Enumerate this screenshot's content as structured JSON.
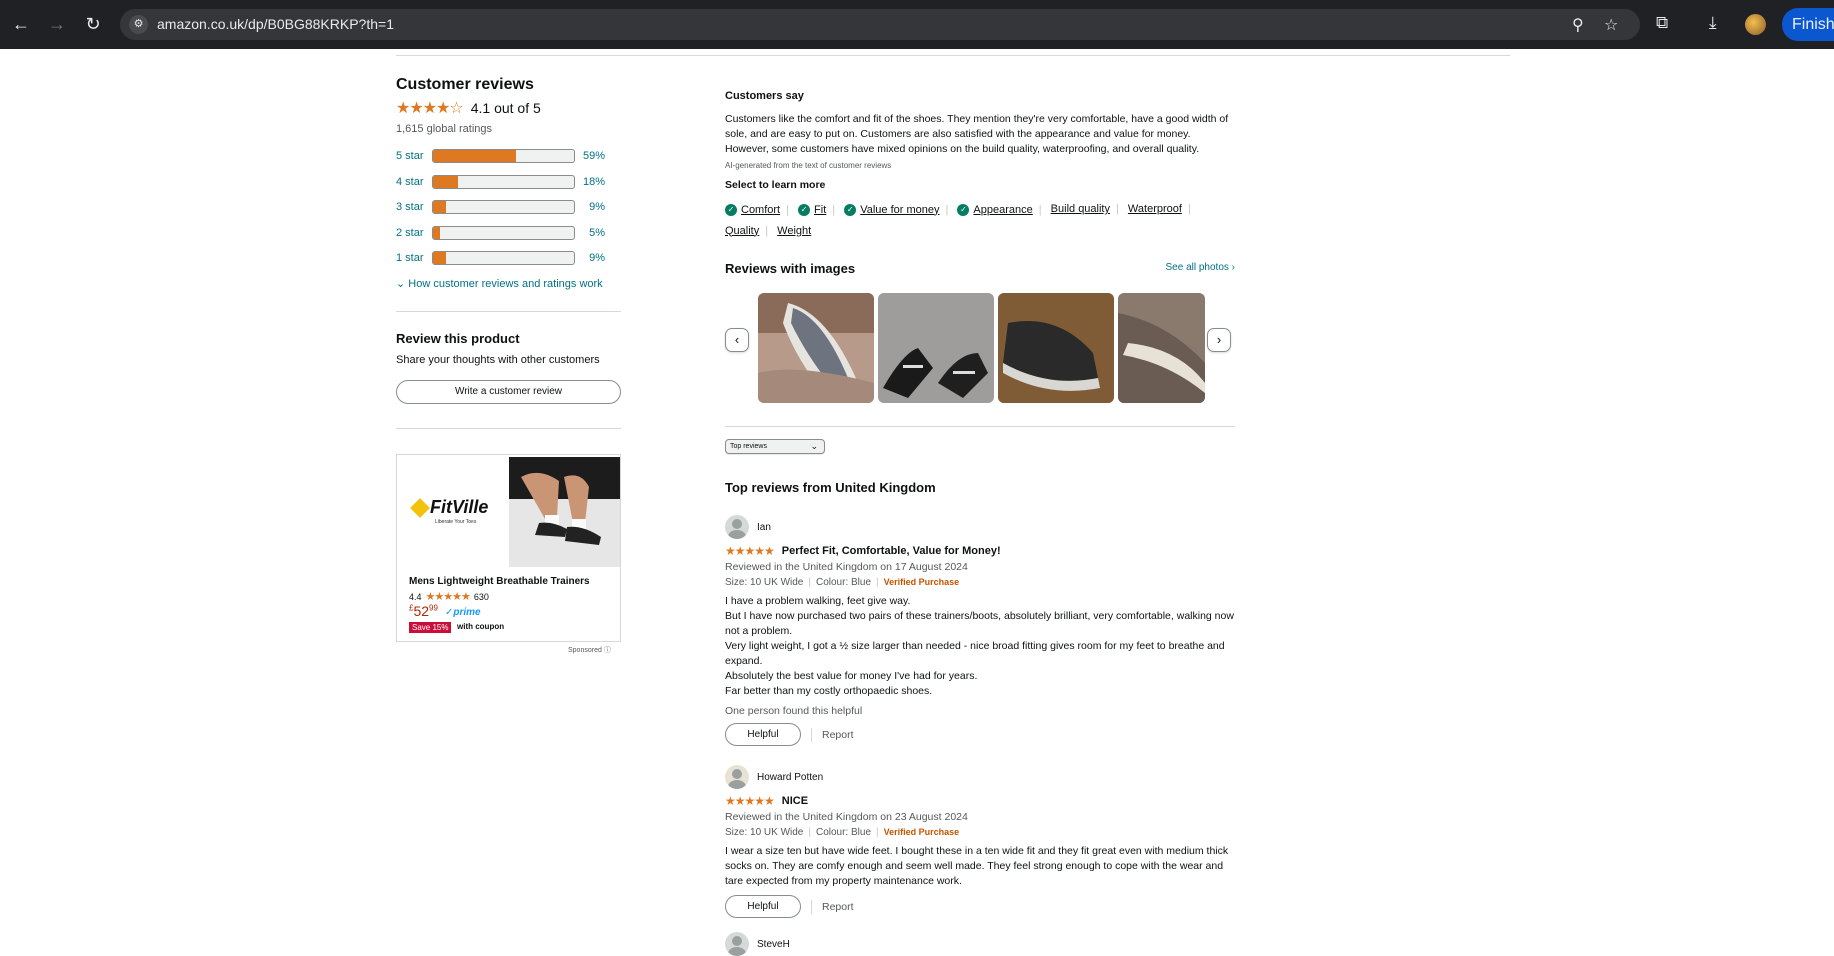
{
  "browser": {
    "url": "amazon.co.uk/dp/B0BG88KRKP?th=1",
    "finish_label": "Finish"
  },
  "ratings": {
    "heading": "Customer reviews",
    "stars": "★★★★☆",
    "average_text": "4.1 out of 5",
    "average": 4.1,
    "global_ratings": "1,615 global ratings",
    "histogram": [
      {
        "label": "5 star",
        "percent_text": "59%",
        "percent": 59
      },
      {
        "label": "4 star",
        "percent_text": "18%",
        "percent": 18
      },
      {
        "label": "3 star",
        "percent_text": "9%",
        "percent": 9
      },
      {
        "label": "2 star",
        "percent_text": "5%",
        "percent": 5
      },
      {
        "label": "1 star",
        "percent_text": "9%",
        "percent": 9
      }
    ],
    "how_link": "How customer reviews and ratings work"
  },
  "review_product": {
    "heading": "Review this product",
    "subtext": "Share your thoughts with other customers",
    "button": "Write a customer review"
  },
  "ad": {
    "brand": "FitVille",
    "tagline": "Liberate Your Toes",
    "title": "Mens Lightweight Breathable Trainers",
    "rating": "4.4",
    "stars": "★★★★★",
    "count": "630",
    "price_currency": "£",
    "price_whole": "52",
    "price_fraction": "99",
    "prime": "prime",
    "save_badge": "Save 15%",
    "coupon_text": "with coupon",
    "sponsored": "Sponsored"
  },
  "customers_say": {
    "heading": "Customers say",
    "summary": "Customers like the comfort and fit of the shoes. They mention they're very comfortable, have a good width of sole, and are easy to put on. Customers are also satisfied with the appearance and value for money. However, some customers have mixed opinions on the build quality, waterproofing, and overall quality.",
    "ai_note": "AI-generated from the text of customer reviews",
    "select_more": "Select to learn more",
    "aspects": [
      {
        "label": "Comfort",
        "positive": true
      },
      {
        "label": "Fit",
        "positive": true
      },
      {
        "label": "Value for money",
        "positive": true
      },
      {
        "label": "Appearance",
        "positive": true
      },
      {
        "label": "Build quality",
        "positive": false
      },
      {
        "label": "Waterproof",
        "positive": false
      },
      {
        "label": "Quality",
        "positive": false
      },
      {
        "label": "Weight",
        "positive": false
      }
    ]
  },
  "images_section": {
    "heading": "Reviews with images",
    "see_all": "See all photos ›",
    "prev_icon": "‹",
    "next_icon": "›"
  },
  "sort": {
    "selected": "Top reviews"
  },
  "top_reviews_heading": "Top reviews from United Kingdom",
  "reviews": [
    {
      "name": "Ian",
      "stars": "★★★★★",
      "title": "Perfect Fit, Comfortable, Value for Money!",
      "meta": "Reviewed in the United Kingdom on 17 August 2024",
      "size": "Size: 10 UK Wide",
      "colour": "Colour: Blue",
      "verified": "Verified Purchase",
      "body": [
        "I have a problem walking, feet give way.",
        "But I have now purchased two pairs of these trainers/boots, absolutely brilliant, very comfortable, walking now not a problem.",
        "Very light weight, I got a ½ size larger than needed - nice broad fitting gives room for my feet to breathe and expand.",
        "Absolutely the best value for money I've had for years.",
        "Far better than my costly orthopaedic shoes."
      ],
      "helpful_count": "One person found this helpful",
      "helpful": "Helpful",
      "report": "Report"
    },
    {
      "name": "Howard Potten",
      "stars": "★★★★★",
      "title": "NICE",
      "meta": "Reviewed in the United Kingdom on 23 August 2024",
      "size": "Size: 10 UK Wide",
      "colour": "Colour: Blue",
      "verified": "Verified Purchase",
      "body": [
        "I wear a size ten but have wide feet. I bought these in a ten wide fit and they fit great even with medium thick socks on. They are comfy enough and seem well made. They feel strong enough to cope with the wear and tare expected from my property maintenance work."
      ],
      "helpful": "Helpful",
      "report": "Report"
    },
    {
      "name": "SteveH"
    }
  ]
}
